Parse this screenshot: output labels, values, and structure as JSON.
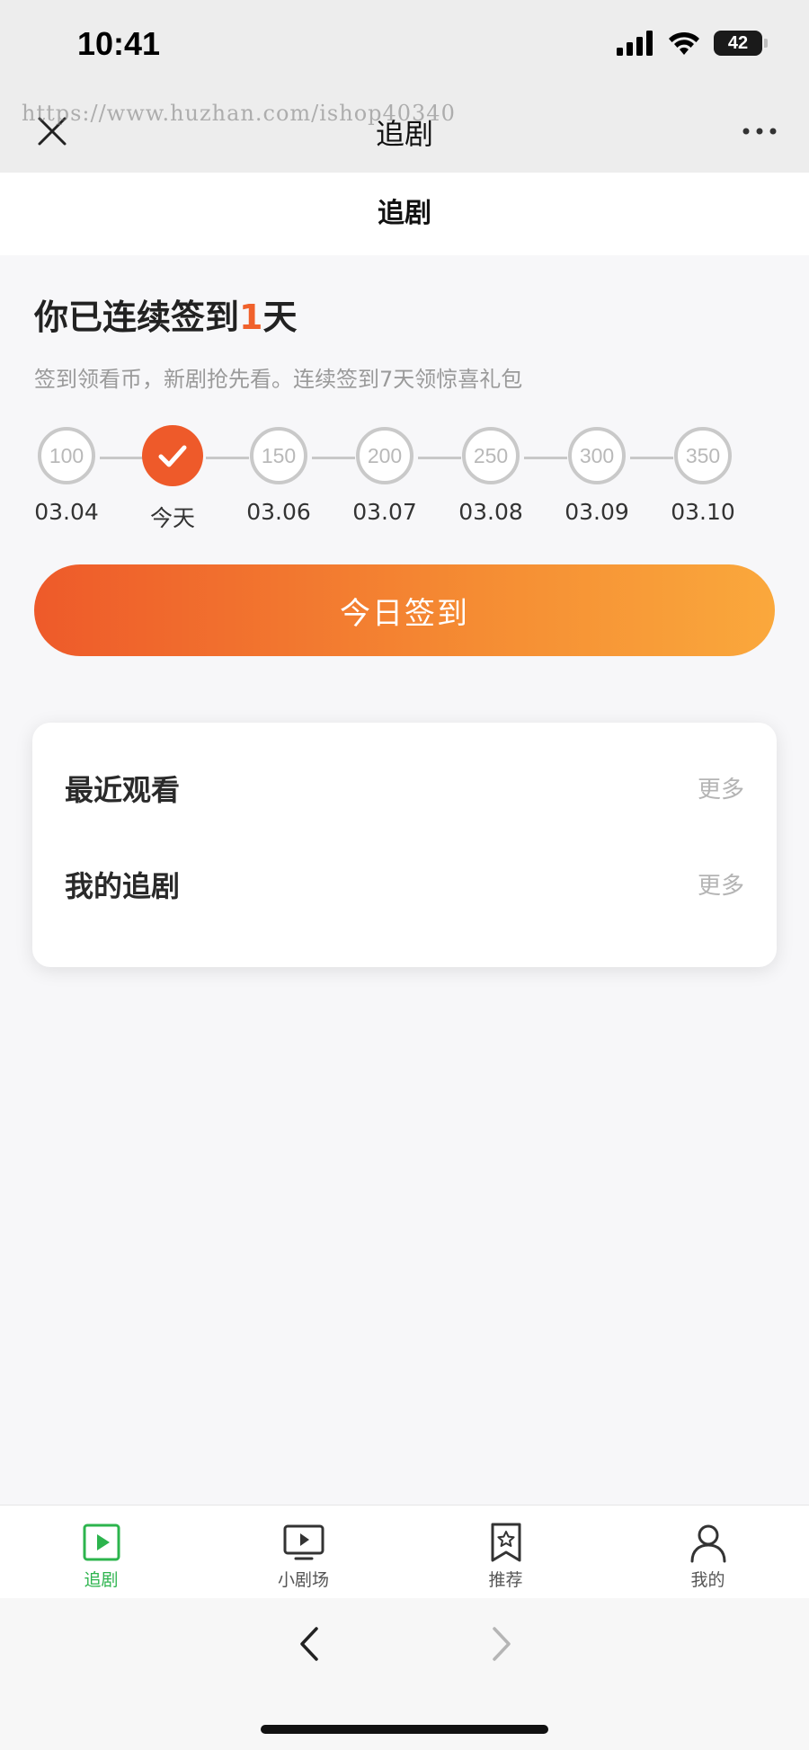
{
  "status_bar": {
    "time": "10:41",
    "battery": "42"
  },
  "nav": {
    "title": "追剧"
  },
  "watermark": "https://www.huzhan.com/ishop40340",
  "header": {
    "title": "追剧"
  },
  "checkin": {
    "title_prefix": "你已连续签到",
    "days": "1",
    "title_suffix": "天",
    "subtitle": "签到领看币，新剧抢先看。连续签到7天领惊喜礼包",
    "button_label": "今日签到",
    "accent_color": "#ee5a2a",
    "days_list": [
      {
        "coins": "100",
        "label": "03.04",
        "done": false
      },
      {
        "coins": "",
        "label": "今天",
        "done": true
      },
      {
        "coins": "150",
        "label": "03.06",
        "done": false
      },
      {
        "coins": "200",
        "label": "03.07",
        "done": false
      },
      {
        "coins": "250",
        "label": "03.08",
        "done": false
      },
      {
        "coins": "300",
        "label": "03.09",
        "done": false
      },
      {
        "coins": "350",
        "label": "03.10",
        "done": false
      }
    ]
  },
  "card": {
    "recent": {
      "label": "最近观看",
      "more": "更多"
    },
    "following": {
      "label": "我的追剧",
      "more": "更多"
    }
  },
  "tabbar": {
    "active_color": "#2cb44d",
    "items": [
      {
        "label": "追剧",
        "icon": "play-square-icon"
      },
      {
        "label": "小剧场",
        "icon": "tv-play-icon"
      },
      {
        "label": "推荐",
        "icon": "bookmark-star-icon"
      },
      {
        "label": "我的",
        "icon": "user-icon"
      }
    ]
  }
}
